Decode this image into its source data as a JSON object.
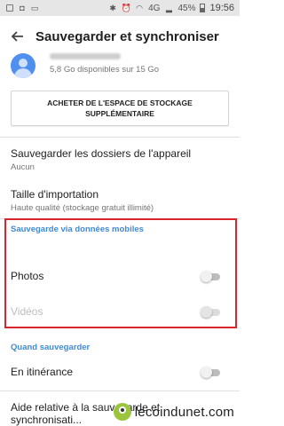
{
  "status_bar": {
    "network": "4G",
    "battery": "45%",
    "time": "19:56"
  },
  "app_bar": {
    "title": "Sauvegarder et synchroniser"
  },
  "account": {
    "storage_text": "5,8 Go disponibles sur 15 Go"
  },
  "buy_button": {
    "label": "ACHETER DE L'ESPACE DE STOCKAGE SUPPLÉMENTAIRE"
  },
  "settings": {
    "backup_folders": {
      "title": "Sauvegarder les dossiers de l'appareil",
      "value": "Aucun"
    },
    "upload_size": {
      "title": "Taille d'importation",
      "value": "Haute qualité (stockage gratuit illimité)"
    }
  },
  "mobile_data_section": {
    "header": "Sauvegarde via données mobiles",
    "items": [
      {
        "label": "Photos",
        "enabled": true,
        "on": false
      },
      {
        "label": "Vidéos",
        "enabled": false,
        "on": false
      }
    ]
  },
  "when_section": {
    "header": "Quand sauvegarder",
    "items": [
      {
        "label": "En itinérance",
        "on": false
      }
    ]
  },
  "help_row": {
    "label": "Aide relative à la sauvegarde et synchronisati..."
  },
  "watermark": {
    "text": "lecoindunet.com"
  },
  "colors": {
    "accent": "#3f8ad9",
    "highlight": "#d9262d"
  }
}
